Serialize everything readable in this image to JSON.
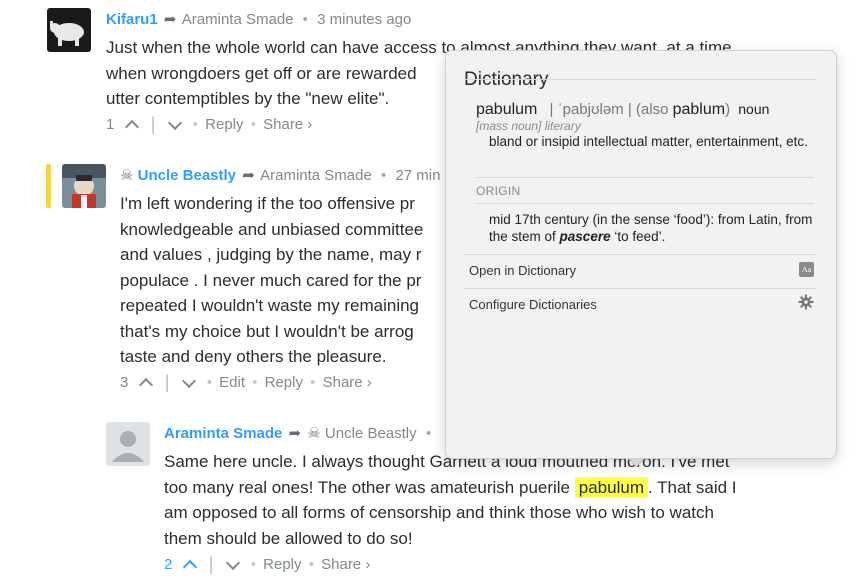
{
  "comments": [
    {
      "author": "Kifaru1",
      "reply_to": "Araminta Smade",
      "time": "3 minutes ago",
      "lines": [
        "Just when the whole world can have access to almost anything they want, at a time",
        "when wrongdoers get off or are rewarded",
        "utter contemptibles by the \"new elite\"."
      ],
      "votes": "1",
      "reply_label": "Reply",
      "share_label": "Share ›"
    },
    {
      "author": "Uncle Beastly",
      "reply_to": "Araminta Smade",
      "time": "27 min",
      "lines": [
        "I'm left wondering if the too offensive pr",
        "knowledgeable and unbiased committee",
        "and values , judging by the name, may r",
        "populace . I never much cared for the pr",
        "repeated I wouldn't waste my remaining",
        "that's my choice but I wouldn't be arrog",
        "taste and deny others the pleasure."
      ],
      "votes": "3",
      "edit_label": "Edit",
      "reply_label": "Reply",
      "share_label": "Share ›"
    },
    {
      "author": "Araminta Smade",
      "reply_to": "Uncle Beastly",
      "lines": [
        "Same here uncle. I always thought Garnett a loud mouthed moron. I've met",
        "too many real ones! The other was amateurish puerile",
        ". That said I",
        "am opposed to all forms of censorship and think those who wish to watch",
        "them should be allowed to do so!"
      ],
      "highlight_word": "pabulum",
      "votes": "2",
      "reply_label": "Reply",
      "share_label": "Share ›"
    }
  ],
  "dictionary": {
    "title": "Dictionary",
    "headword": "pabulum",
    "pronunciation": "| ˈpabjʊləm |",
    "also_prefix": "(also",
    "also_word": "pablum",
    "also_suffix": ")",
    "part_of_speech": "noun",
    "register": "[mass noun] literary",
    "definition": "bland or insipid intellectual matter, entertainment, etc.",
    "origin_label": "ORIGIN",
    "origin_pre": "mid 17th century (in the sense ‘food’): from Latin, from the stem of ",
    "origin_word": "pascere",
    "origin_post": " ‘to feed’.",
    "open_label": "Open in Dictionary",
    "open_icon_text": "Aa",
    "configure_label": "Configure Dictionaries"
  }
}
